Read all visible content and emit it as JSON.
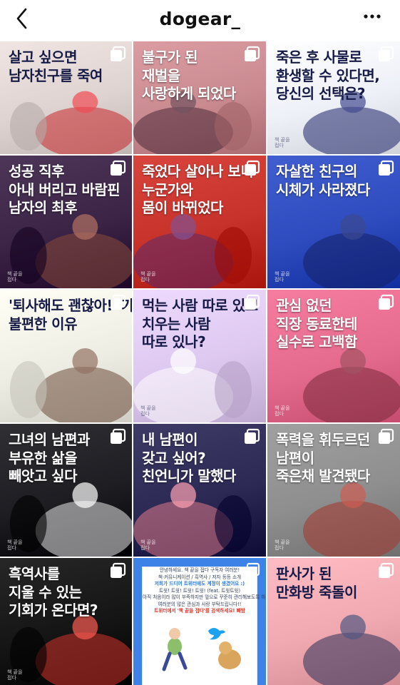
{
  "header": {
    "title": "dogear_",
    "back_icon": "chevron-left-icon",
    "more_icon": "more-horizontal-icon"
  },
  "posts": [
    {
      "lines": [
        "살고 싶으면",
        "남자친구를 죽여"
      ],
      "bg": "#ded3d0",
      "theme": "dark",
      "accent": "#c8242a"
    },
    {
      "lines": [
        "불구가 된",
        "재벌을",
        "사랑하게 되었다"
      ],
      "bg": "#c98a90",
      "theme": "light",
      "accent": "#4a2a38"
    },
    {
      "lines": [
        "죽은 후 사물로",
        "환생할 수 있다면,",
        "당신의 선택은?"
      ],
      "bg": "#eef0f8",
      "theme": "dark",
      "accent": "#1b2368",
      "watermark": [
        "책 끝을",
        "접다"
      ]
    },
    {
      "lines": [
        "성공 직후",
        "아내 버리고 바람핀",
        "남자의 최후"
      ],
      "bg": "#3b2446",
      "theme": "light",
      "accent": "#8a4a3a",
      "watermark": [
        "책 끝을",
        "접다"
      ]
    },
    {
      "lines": [
        "죽었다 살아나 보니",
        "누군가와",
        "몸이 바뀌었다"
      ],
      "bg": "#c7322b",
      "theme": "light",
      "accent": "#5b2a6a",
      "watermark": [
        "책 끝을",
        "접다"
      ]
    },
    {
      "lines": [
        "자살한 친구의",
        "시체가 사라졌다"
      ],
      "bg": "#2f4cbf",
      "theme": "light",
      "accent": "#142066",
      "watermark": [
        "책 끝을",
        "접다"
      ]
    },
    {
      "lines": [
        "'퇴사해도 괜찮아!' 가",
        "불편한 이유"
      ],
      "bg": "#eeede3",
      "theme": "dark",
      "accent": "#6b4a3a"
    },
    {
      "lines": [
        "먹는 사람 따로 있고",
        "치우는 사람",
        "따로 있나?"
      ],
      "bg": "#ddc8ef",
      "theme": "dark",
      "accent": "#ffffff",
      "watermark": [
        "책 끝을",
        "접다"
      ]
    },
    {
      "lines": [
        "관심 없던",
        "직장 동료한테",
        "실수로 고백함"
      ],
      "bg": "#e56b8e",
      "theme": "light",
      "accent": "#7a2a3a",
      "watermark": [
        "책 끝을",
        "접다"
      ]
    },
    {
      "lines": [
        "그녀의 남편과",
        "부유한 삶을",
        "빼앗고 싶다"
      ],
      "bg": "#1d1d22",
      "theme": "light",
      "accent": "#e8e8e8",
      "watermark": [
        "책 끝을",
        "접다"
      ]
    },
    {
      "lines": [
        "내 남편이",
        "갖고 싶어?",
        "친언니가 말했다"
      ],
      "bg": "#2c2a55",
      "theme": "light",
      "accent": "#e07a8a",
      "watermark": [
        "책 끝을",
        "접다"
      ]
    },
    {
      "lines": [
        "폭력을 휘두르던",
        "남편이",
        "죽은채 발견됐다"
      ],
      "bg": "#8e8e8e",
      "theme": "light",
      "accent": "#a4342a",
      "watermark": [
        "책 끝을",
        "접다"
      ]
    },
    {
      "lines": [
        "흑역사를",
        "지울 수 있는",
        "기회가 온다면?"
      ],
      "bg": "#151515",
      "theme": "light",
      "accent": "#d2332b",
      "watermark": [
        "책 끝을",
        "접다"
      ]
    },
    {
      "notice": true,
      "bg": "#3d82e6",
      "notice_lines": [
        "안녕하세요. 책 끝을 접다 구독자 여러분!",
        "책·커뮤니케이션 / 흑역사 / 저자 등등 소개",
        "저희가 드디어 트위터에도 계정이 생겼어요 :)",
        "트윗! 트윗! 트윗! 트윗! (feat. 트윗트윗)",
        "아직 처음이라 많이 부족하지만 앞으로 꾸준히 관리해보도록 하겠습니다!",
        "여러분의 많은 관심과 사랑 부탁드립니다!!",
        "트위터에서 '책 끝을 접다'를 검색하세요! 빠밤"
      ]
    },
    {
      "lines": [
        "판사가 된",
        "만화방 죽돌이"
      ],
      "bg": "#f1a9b1",
      "theme": "dark",
      "accent": "#2b2f5a"
    }
  ]
}
